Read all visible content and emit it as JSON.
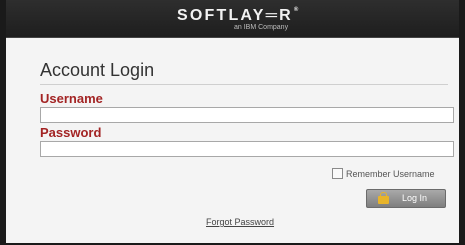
{
  "header": {
    "brand": "SOFTLAY═R",
    "brand_mark": "®",
    "tagline": "an IBM Company"
  },
  "login": {
    "title": "Account Login",
    "username_label": "Username",
    "username_value": "",
    "password_label": "Password",
    "password_value": "",
    "remember_label": "Remember Username",
    "remember_checked": false,
    "login_button_label": "Log In",
    "forgot_password_label": "Forgot Password"
  },
  "colors": {
    "header_bg": "#242424",
    "label_red": "#a32424",
    "button_gray": "#8e8e8e",
    "lock_yellow": "#e8b42a"
  },
  "icons": {
    "login_button_icon": "lock-icon"
  }
}
